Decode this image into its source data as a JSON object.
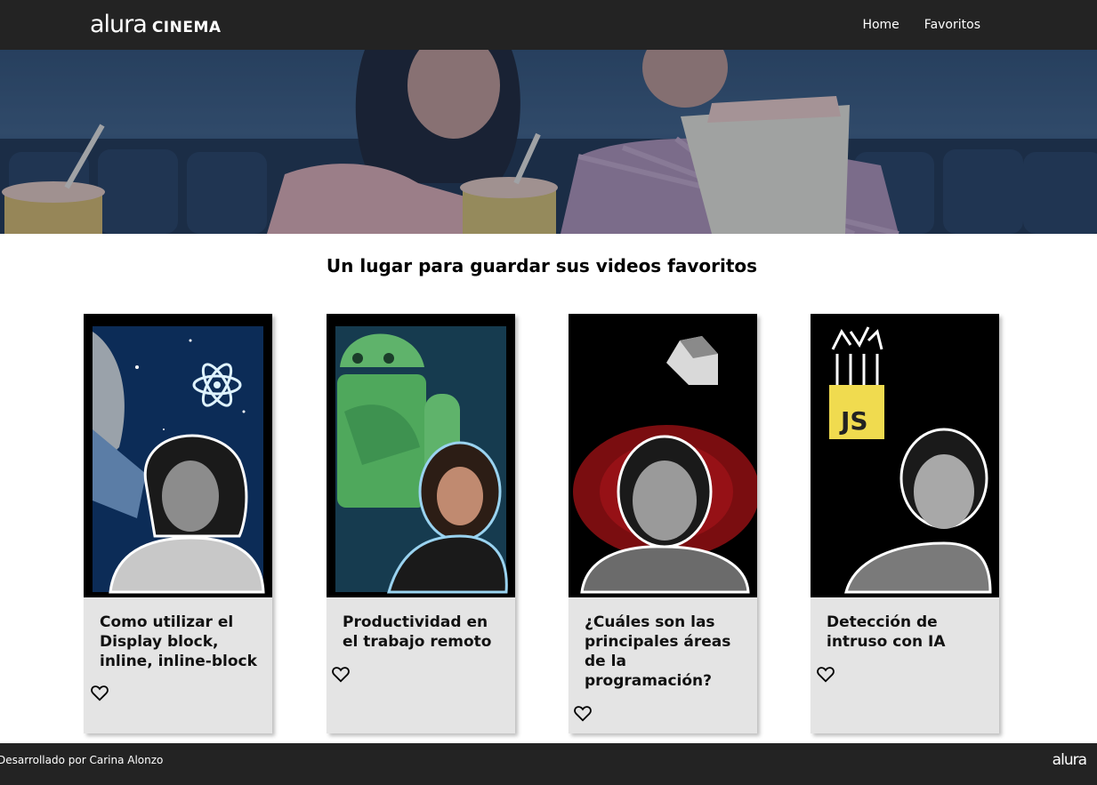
{
  "header": {
    "logo_script": "alura",
    "logo_word": "CINEMA",
    "nav": [
      "Home",
      "Favoritos"
    ]
  },
  "main": {
    "title": "Un lugar para guardar sus videos favoritos",
    "cards": [
      {
        "title": "Como utilizar el Display block, inline, inline-block",
        "fav_icon": "heart-outline-icon"
      },
      {
        "title": "Productividad en el trabajo remoto",
        "fav_icon": "heart-outline-icon"
      },
      {
        "title": "¿Cuáles son las principales áreas de la programación?",
        "fav_icon": "heart-outline-icon"
      },
      {
        "title": "Detección de intruso con IA",
        "fav_icon": "heart-outline-icon"
      }
    ],
    "thumb_badges": {
      "js": "JS"
    }
  },
  "footer": {
    "credit": "Desarrollado por Carina Alonzo",
    "logo": "alura"
  },
  "colors": {
    "header_bg": "#232323",
    "card_bg": "#e4e4e4",
    "js_yellow": "#f0db4f"
  }
}
